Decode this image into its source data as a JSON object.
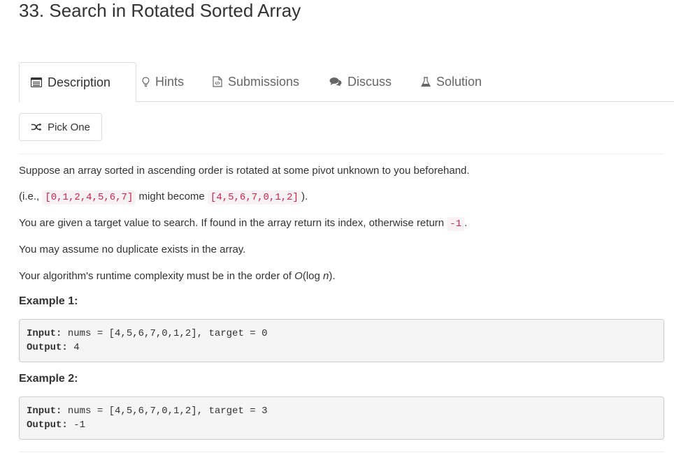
{
  "problem": {
    "title": "33. Search in Rotated Sorted Array"
  },
  "tabs": [
    {
      "label": "Description",
      "icon": "description-icon",
      "active": true
    },
    {
      "label": "Hints",
      "icon": "lightbulb-icon",
      "active": false
    },
    {
      "label": "Submissions",
      "icon": "code-file-icon",
      "active": false
    },
    {
      "label": "Discuss",
      "icon": "comments-icon",
      "active": false
    },
    {
      "label": "Solution",
      "icon": "flask-icon",
      "active": false
    }
  ],
  "pick_one": {
    "label": "Pick One",
    "icon": "shuffle-icon"
  },
  "description": {
    "p1": "Suppose an array sorted in ascending order is rotated at some pivot unknown to you beforehand.",
    "p2_prefix": "(i.e., ",
    "p2_code1": "[0,1,2,4,5,6,7]",
    "p2_middle": " might become ",
    "p2_code2": "[4,5,6,7,0,1,2]",
    "p2_suffix": ").",
    "p3_prefix": "You are given a target value to search. If found in the array return its index, otherwise return ",
    "p3_code": "-1",
    "p3_suffix": ".",
    "p4": "You may assume no duplicate exists in the array.",
    "p5_prefix": "Your algorithm's runtime complexity must be in the order of ",
    "p5_o": "O",
    "p5_open": "(log ",
    "p5_n": "n",
    "p5_close": ")."
  },
  "examples": [
    {
      "heading": "Example 1:",
      "input_label": "Input:",
      "input_value": " nums = [4,5,6,7,0,1,2], target = 0",
      "output_label": "Output:",
      "output_value": " 4"
    },
    {
      "heading": "Example 2:",
      "input_label": "Input:",
      "input_value": " nums = [4,5,6,7,0,1,2], target = 3",
      "output_label": "Output:",
      "output_value": " -1"
    }
  ],
  "colors": {
    "code_text": "#c7254e",
    "code_bg": "#f9f2f4",
    "pre_bg": "#f5f5f5"
  }
}
